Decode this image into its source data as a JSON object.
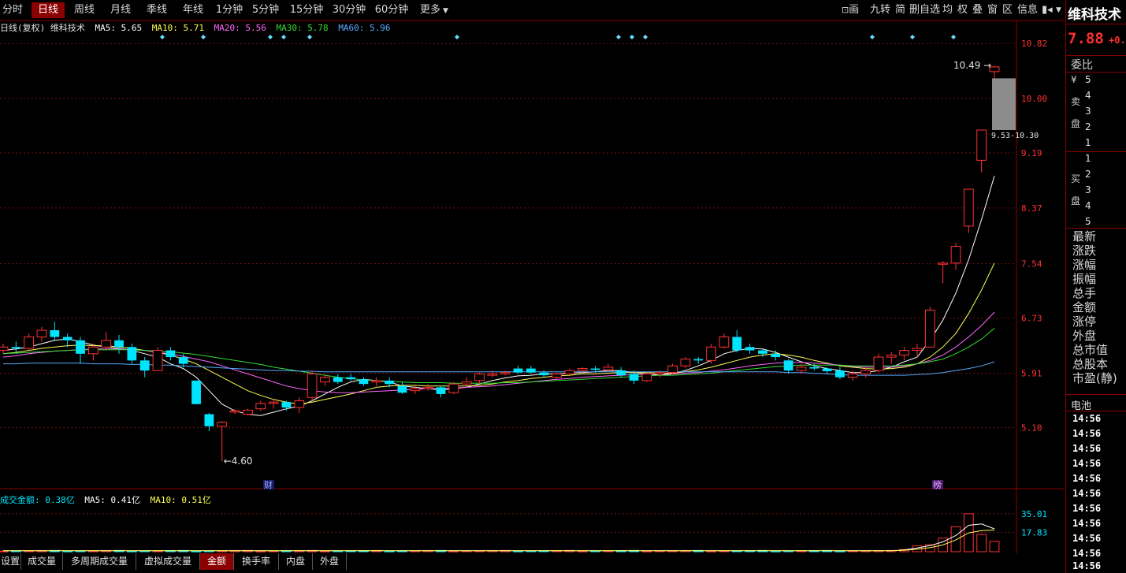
{
  "period_tabs": [
    "分时",
    "日线",
    "周线",
    "月线",
    "季线",
    "年线",
    "1分钟",
    "5分钟",
    "15分钟",
    "30分钟",
    "60分钟"
  ],
  "active_period": "日线",
  "more_label": "更多",
  "toolbar": [
    "画",
    "九转",
    "简",
    "删自选",
    "均",
    "权",
    "叠",
    "窗",
    "区",
    "信息"
  ],
  "legend": {
    "title": "日线(复权) 维科技术",
    "ma5": "MA5: 5.65",
    "ma10": "MA10: 5.71",
    "ma20": "MA20: 5.56",
    "ma30": "MA30: 5.78",
    "ma60": "MA60: 5.96"
  },
  "colors": {
    "up": "#ff3232",
    "down": "#00e5ff",
    "ma5": "#ffffff",
    "ma10": "#ffff55",
    "ma20": "#ff66ff",
    "ma30": "#33dd33",
    "ma60": "#55aaff",
    "accent_tab": "#8b0000"
  },
  "chart_data": {
    "type": "candlestick",
    "y_axis_ticks": [
      10.82,
      10.0,
      9.19,
      8.37,
      7.54,
      6.73,
      5.91,
      5.1
    ],
    "ylim": [
      4.25,
      10.95
    ],
    "annotations": {
      "high_label": "10.49",
      "low_label": "4.60",
      "range_label": "9.53-10.30",
      "event_left": "财",
      "event_right": "榜"
    },
    "candles": [
      [
        6.25,
        6.35,
        6.2,
        6.3
      ],
      [
        6.3,
        6.38,
        6.2,
        6.28
      ],
      [
        6.28,
        6.5,
        6.25,
        6.45
      ],
      [
        6.45,
        6.6,
        6.38,
        6.55
      ],
      [
        6.55,
        6.68,
        6.4,
        6.45
      ],
      [
        6.45,
        6.5,
        6.3,
        6.4
      ],
      [
        6.4,
        6.45,
        6.05,
        6.2
      ],
      [
        6.2,
        6.35,
        6.1,
        6.3
      ],
      [
        6.3,
        6.52,
        6.25,
        6.4
      ],
      [
        6.4,
        6.48,
        6.2,
        6.3
      ],
      [
        6.3,
        6.35,
        6.05,
        6.1
      ],
      [
        6.1,
        6.15,
        5.85,
        5.95
      ],
      [
        5.95,
        6.3,
        5.95,
        6.25
      ],
      [
        6.25,
        6.3,
        6.1,
        6.15
      ],
      [
        6.15,
        6.2,
        6.0,
        6.05
      ],
      [
        5.8,
        5.8,
        5.45,
        5.45
      ],
      [
        5.3,
        5.32,
        5.05,
        5.12
      ],
      [
        5.12,
        5.2,
        4.6,
        5.18
      ],
      [
        5.35,
        5.38,
        5.3,
        5.35
      ],
      [
        5.3,
        5.38,
        5.28,
        5.36
      ],
      [
        5.38,
        5.5,
        5.35,
        5.46
      ],
      [
        5.46,
        5.52,
        5.38,
        5.48
      ],
      [
        5.48,
        5.5,
        5.35,
        5.4
      ],
      [
        5.4,
        5.55,
        5.32,
        5.5
      ],
      [
        5.55,
        5.95,
        5.5,
        5.9
      ],
      [
        5.78,
        5.9,
        5.72,
        5.85
      ],
      [
        5.85,
        5.9,
        5.75,
        5.78
      ],
      [
        5.85,
        5.9,
        5.8,
        5.82
      ],
      [
        5.82,
        5.85,
        5.72,
        5.75
      ],
      [
        5.78,
        5.85,
        5.72,
        5.8
      ],
      [
        5.8,
        5.85,
        5.7,
        5.75
      ],
      [
        5.72,
        5.78,
        5.6,
        5.62
      ],
      [
        5.65,
        5.72,
        5.6,
        5.68
      ],
      [
        5.68,
        5.75,
        5.65,
        5.7
      ],
      [
        5.7,
        5.72,
        5.55,
        5.6
      ],
      [
        5.62,
        5.78,
        5.6,
        5.75
      ],
      [
        5.75,
        5.85,
        5.72,
        5.78
      ],
      [
        5.8,
        5.92,
        5.75,
        5.9
      ],
      [
        5.88,
        5.95,
        5.85,
        5.9
      ],
      [
        5.9,
        5.95,
        5.88,
        5.92
      ],
      [
        5.98,
        6.02,
        5.9,
        5.92
      ],
      [
        5.98,
        6.02,
        5.9,
        5.92
      ],
      [
        5.92,
        5.95,
        5.85,
        5.88
      ],
      [
        5.85,
        5.92,
        5.82,
        5.9
      ],
      [
        5.9,
        5.98,
        5.88,
        5.95
      ],
      [
        5.95,
        6.0,
        5.92,
        5.98
      ],
      [
        5.98,
        6.02,
        5.92,
        5.96
      ],
      [
        5.96,
        6.05,
        5.95,
        6.0
      ],
      [
        5.95,
        6.0,
        5.85,
        5.88
      ],
      [
        5.9,
        5.95,
        5.75,
        5.8
      ],
      [
        5.8,
        5.92,
        5.78,
        5.9
      ],
      [
        5.9,
        5.95,
        5.85,
        5.92
      ],
      [
        5.92,
        6.05,
        5.9,
        6.02
      ],
      [
        6.02,
        6.15,
        5.98,
        6.12
      ],
      [
        6.12,
        6.15,
        6.05,
        6.1
      ],
      [
        6.1,
        6.35,
        6.05,
        6.3
      ],
      [
        6.3,
        6.5,
        6.28,
        6.45
      ],
      [
        6.45,
        6.55,
        6.22,
        6.25
      ],
      [
        6.3,
        6.35,
        6.2,
        6.25
      ],
      [
        6.25,
        6.28,
        6.15,
        6.2
      ],
      [
        6.2,
        6.25,
        6.1,
        6.15
      ],
      [
        6.1,
        6.12,
        5.9,
        5.95
      ],
      [
        5.95,
        6.05,
        5.9,
        6.0
      ],
      [
        6.0,
        6.05,
        5.95,
        5.98
      ],
      [
        5.98,
        6.0,
        5.9,
        5.94
      ],
      [
        5.95,
        6.0,
        5.82,
        5.85
      ],
      [
        5.85,
        5.95,
        5.8,
        5.9
      ],
      [
        5.9,
        6.0,
        5.85,
        5.95
      ],
      [
        5.95,
        6.2,
        5.92,
        6.15
      ],
      [
        6.15,
        6.22,
        6.05,
        6.18
      ],
      [
        6.18,
        6.3,
        6.1,
        6.25
      ],
      [
        6.25,
        6.35,
        6.15,
        6.28
      ],
      [
        6.3,
        6.9,
        6.3,
        6.85
      ],
      [
        7.55,
        7.58,
        7.25,
        7.55
      ],
      [
        7.55,
        7.85,
        7.45,
        7.8
      ],
      [
        8.1,
        8.65,
        8.0,
        8.65
      ],
      [
        9.08,
        9.53,
        8.9,
        9.53
      ],
      [
        10.4,
        10.49,
        10.3,
        10.47
      ]
    ],
    "ma_series": {
      "ma5": [
        6.25,
        6.27,
        6.3,
        6.35,
        6.4,
        6.42,
        6.38,
        6.33,
        6.3,
        6.28,
        6.25,
        6.2,
        6.15,
        6.05,
        5.98,
        5.85,
        5.65,
        5.45,
        5.35,
        5.3,
        5.28,
        5.33,
        5.38,
        5.42,
        5.5,
        5.6,
        5.7,
        5.78,
        5.82,
        5.8,
        5.78,
        5.72,
        5.7,
        5.68,
        5.66,
        5.68,
        5.7,
        5.75,
        5.8,
        5.84,
        5.87,
        5.88,
        5.9,
        5.9,
        5.91,
        5.92,
        5.93,
        5.95,
        5.95,
        5.92,
        5.9,
        5.88,
        5.9,
        5.95,
        6.02,
        6.1,
        6.2,
        6.25,
        6.28,
        6.27,
        6.22,
        6.15,
        6.08,
        6.02,
        5.98,
        5.95,
        5.92,
        5.92,
        5.95,
        6.0,
        6.08,
        6.15,
        6.4,
        6.7,
        7.1,
        7.6,
        8.2,
        8.85
      ],
      "ma10": [
        6.2,
        6.22,
        6.25,
        6.28,
        6.3,
        6.32,
        6.33,
        6.32,
        6.32,
        6.3,
        6.28,
        6.25,
        6.22,
        6.18,
        6.12,
        6.05,
        5.95,
        5.85,
        5.75,
        5.65,
        5.58,
        5.52,
        5.48,
        5.45,
        5.48,
        5.52,
        5.56,
        5.6,
        5.65,
        5.7,
        5.72,
        5.73,
        5.73,
        5.72,
        5.72,
        5.72,
        5.72,
        5.73,
        5.75,
        5.78,
        5.8,
        5.83,
        5.85,
        5.87,
        5.88,
        5.9,
        5.9,
        5.91,
        5.92,
        5.92,
        5.92,
        5.91,
        5.91,
        5.93,
        5.96,
        6.0,
        6.05,
        6.1,
        6.15,
        6.18,
        6.2,
        6.18,
        6.15,
        6.1,
        6.06,
        6.02,
        6.0,
        5.98,
        5.97,
        5.98,
        6.0,
        6.05,
        6.15,
        6.3,
        6.5,
        6.8,
        7.15,
        7.55
      ],
      "ma20": [
        6.15,
        6.17,
        6.2,
        6.22,
        6.24,
        6.25,
        6.26,
        6.27,
        6.27,
        6.27,
        6.26,
        6.25,
        6.22,
        6.2,
        6.16,
        6.12,
        6.08,
        6.02,
        5.96,
        5.9,
        5.84,
        5.78,
        5.72,
        5.68,
        5.65,
        5.63,
        5.62,
        5.62,
        5.63,
        5.64,
        5.65,
        5.66,
        5.67,
        5.68,
        5.68,
        5.69,
        5.7,
        5.71,
        5.72,
        5.74,
        5.76,
        5.78,
        5.8,
        5.82,
        5.83,
        5.85,
        5.86,
        5.87,
        5.88,
        5.89,
        5.89,
        5.9,
        5.9,
        5.91,
        5.92,
        5.94,
        5.96,
        5.99,
        6.02,
        6.04,
        6.06,
        6.07,
        6.07,
        6.06,
        6.05,
        6.03,
        6.01,
        6.0,
        6.0,
        6.0,
        6.02,
        6.05,
        6.1,
        6.18,
        6.3,
        6.45,
        6.62,
        6.82
      ],
      "ma30": [
        6.2,
        6.21,
        6.22,
        6.23,
        6.24,
        6.25,
        6.26,
        6.26,
        6.26,
        6.26,
        6.26,
        6.25,
        6.24,
        6.23,
        6.21,
        6.19,
        6.16,
        6.13,
        6.1,
        6.07,
        6.04,
        6.0,
        5.97,
        5.94,
        5.91,
        5.88,
        5.85,
        5.83,
        5.81,
        5.8,
        5.79,
        5.78,
        5.77,
        5.77,
        5.77,
        5.76,
        5.76,
        5.76,
        5.76,
        5.77,
        5.77,
        5.78,
        5.79,
        5.8,
        5.81,
        5.82,
        5.83,
        5.84,
        5.85,
        5.86,
        5.87,
        5.88,
        5.88,
        5.89,
        5.9,
        5.91,
        5.93,
        5.95,
        5.97,
        5.99,
        6.01,
        6.02,
        6.03,
        6.03,
        6.03,
        6.03,
        6.02,
        6.02,
        6.02,
        6.02,
        6.03,
        6.05,
        6.08,
        6.12,
        6.2,
        6.3,
        6.42,
        6.58
      ],
      "ma60": [
        6.05,
        6.05,
        6.06,
        6.06,
        6.06,
        6.06,
        6.06,
        6.05,
        6.05,
        6.05,
        6.04,
        6.04,
        6.03,
        6.03,
        6.02,
        6.01,
        6.0,
        5.99,
        5.98,
        5.97,
        5.96,
        5.95,
        5.95,
        5.94,
        5.94,
        5.93,
        5.93,
        5.93,
        5.93,
        5.93,
        5.93,
        5.93,
        5.93,
        5.93,
        5.93,
        5.93,
        5.93,
        5.93,
        5.93,
        5.93,
        5.93,
        5.93,
        5.93,
        5.93,
        5.93,
        5.93,
        5.93,
        5.93,
        5.93,
        5.93,
        5.93,
        5.93,
        5.93,
        5.93,
        5.93,
        5.93,
        5.93,
        5.93,
        5.93,
        5.93,
        5.93,
        5.92,
        5.92,
        5.91,
        5.9,
        5.89,
        5.88,
        5.88,
        5.88,
        5.88,
        5.88,
        5.89,
        5.9,
        5.92,
        5.95,
        5.98,
        6.02,
        6.08
      ]
    },
    "volume": {
      "legend_title": "成交金额: 0.38亿",
      "ma5_label": "MA5: 0.41亿",
      "ma10_label": "MA10: 0.51亿",
      "y_axis_ticks": [
        35.01,
        17.83
      ],
      "ylim": [
        0,
        40
      ],
      "recent_values": [
        2.1,
        5.5,
        6.5,
        12.5,
        23.0,
        35.0,
        16.0,
        9.5
      ]
    }
  },
  "bottom_tabs": [
    "设置",
    "成交量",
    "多周期成交量",
    "虚拟成交量",
    "金额",
    "换手率",
    "内盘",
    "外盘"
  ],
  "active_bottom_tab": "金额",
  "right_panel": {
    "stock_name": "维科技术",
    "price": "7.88",
    "change": "+0.",
    "order_book_title": "委比",
    "yen_mark": "¥",
    "sell_label_1": "卖",
    "sell_label_2": "盘",
    "buy_label_1": "买",
    "buy_label_2": "盘",
    "sell_levels": [
      "5",
      "4",
      "3",
      "2",
      "1"
    ],
    "buy_levels": [
      "1",
      "2",
      "3",
      "4",
      "5"
    ],
    "fields": [
      "最新",
      "涨跌",
      "涨幅",
      "振幅",
      "总手",
      "金额",
      "涨停",
      "外盘",
      "总市值",
      "总股本",
      "市盈(静)"
    ],
    "tick_title": "电池",
    "tick_times": [
      "14:56",
      "14:56",
      "14:56",
      "14:56",
      "14:56",
      "14:56",
      "14:56",
      "14:56",
      "14:56",
      "14:56",
      "14:56"
    ]
  }
}
